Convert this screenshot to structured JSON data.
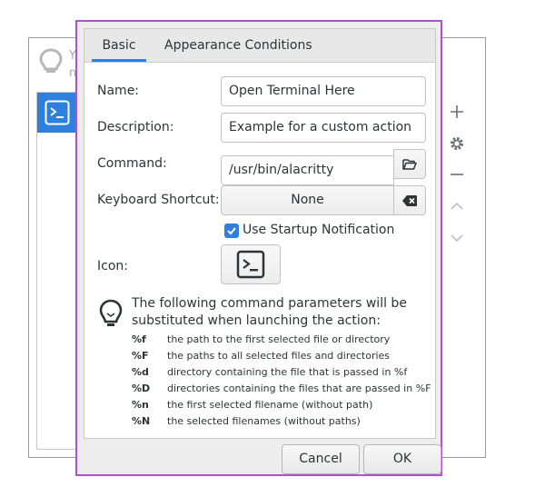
{
  "background_window": {
    "text_line1": "Y",
    "text_line2": "n",
    "side_buttons": [
      "add-icon",
      "gear-icon",
      "remove-icon",
      "chevron-up-icon",
      "chevron-down-icon"
    ]
  },
  "dialog": {
    "tabs": [
      {
        "label": "Basic",
        "active": true
      },
      {
        "label": "Appearance Conditions",
        "active": false
      }
    ],
    "fields": {
      "name_label": "Name:",
      "name_value": "Open Terminal Here",
      "description_label": "Description:",
      "description_value": "Example for a custom action",
      "command_label": "Command:",
      "command_value": "/usr/bin/alacritty",
      "shortcut_label": "Keyboard Shortcut:",
      "shortcut_value": "None",
      "startup_label": "Use Startup Notification",
      "startup_checked": true,
      "icon_label": "Icon:"
    },
    "info": {
      "text": "The following command parameters will be substituted when launching the action:",
      "params": [
        {
          "key": "%f",
          "desc": "the path to the first selected file or directory"
        },
        {
          "key": "%F",
          "desc": "the paths to all selected files and directories"
        },
        {
          "key": "%d",
          "desc": "directory containing the file that is passed in %f"
        },
        {
          "key": "%D",
          "desc": "directories containing the files that are passed in %F"
        },
        {
          "key": "%n",
          "desc": "the first selected filename (without path)"
        },
        {
          "key": "%N",
          "desc": "the selected filenames (without paths)"
        }
      ]
    },
    "buttons": {
      "cancel": "Cancel",
      "ok": "OK"
    }
  },
  "colors": {
    "accent": "#2f7fdd",
    "dialog_border": "#b04fd0"
  }
}
